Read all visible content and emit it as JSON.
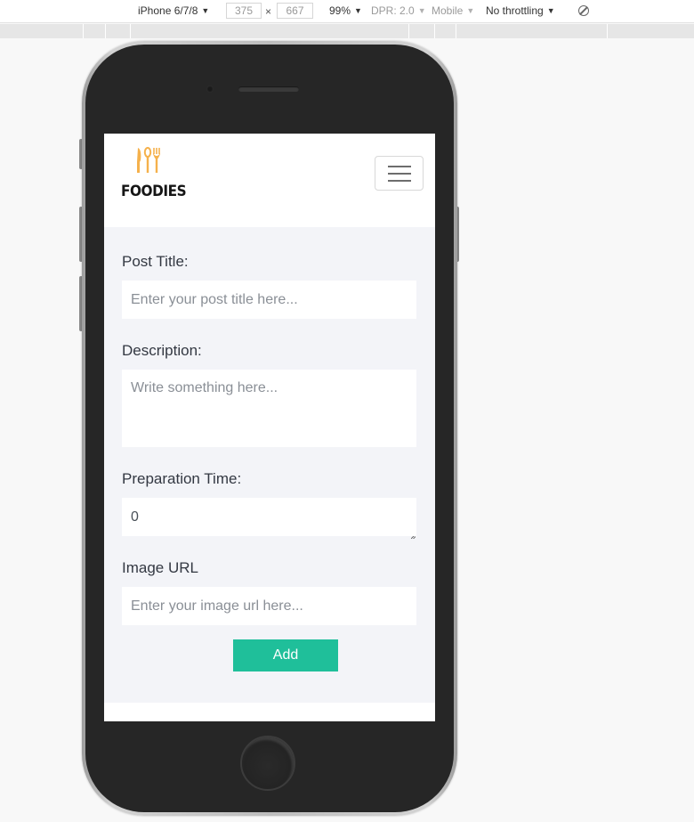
{
  "devtools": {
    "device": "iPhone 6/7/8",
    "width": "375",
    "times": "×",
    "height": "667",
    "zoom": "99%",
    "dpr": "DPR: 2.0",
    "mode": "Mobile",
    "throttling": "No throttling",
    "rotate_icon": "rotate-icon"
  },
  "navbar": {
    "brand_name": "FOODIES",
    "brand_icon": "cutlery-icon",
    "toggler_icon": "hamburger-menu-icon",
    "accent_color": "#f5b14c"
  },
  "form": {
    "title_label": "Post Title:",
    "title_placeholder": "Enter your post title here...",
    "description_label": "Description:",
    "description_placeholder": "Write something here...",
    "prep_time_label": "Preparation Time:",
    "prep_time_value": "0",
    "image_url_label": "Image URL",
    "image_url_placeholder": "Enter your image url here...",
    "submit_label": "Add",
    "button_color": "#1fbf9a",
    "background_color": "#f3f4f8"
  }
}
